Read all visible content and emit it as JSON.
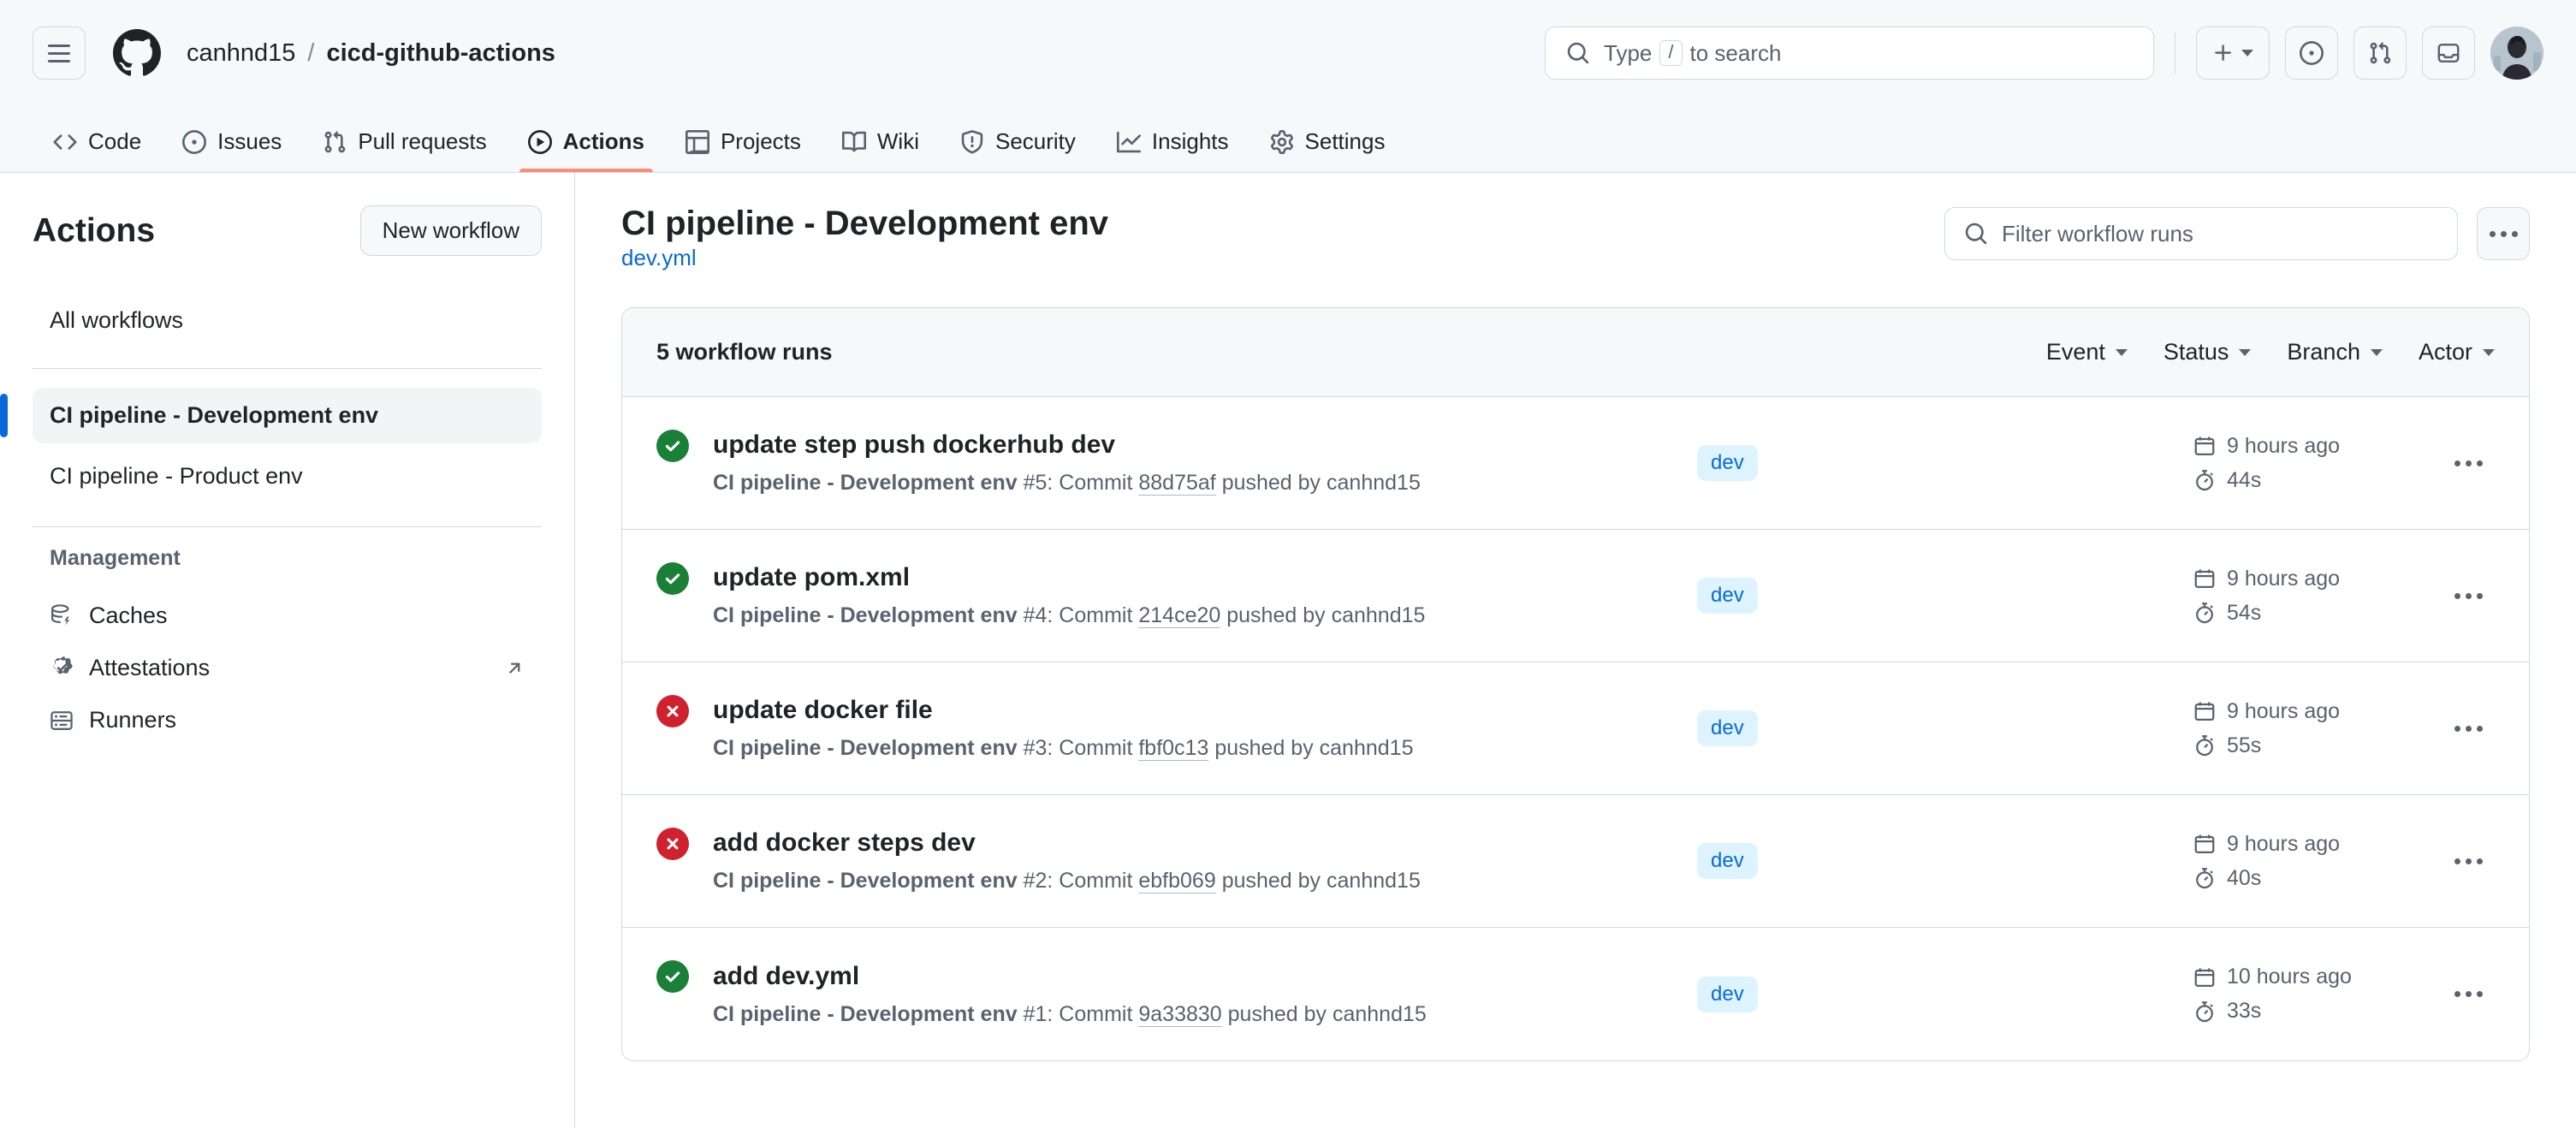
{
  "header": {
    "hamburger_label": "Open navigation menu",
    "breadcrumb": {
      "owner": "canhnd15",
      "separator": "/",
      "repo": "cicd-github-actions"
    },
    "search": {
      "placeholder_prefix": "Type",
      "placeholder_key": "/",
      "placeholder_suffix": "to search"
    },
    "icons": {
      "github_logo": "github-mark-icon",
      "search": "search-icon",
      "create_new": "plus-icon",
      "create_new_caret": "chevron-down-icon",
      "issues": "issue-opened-icon",
      "pull_requests": "git-pull-request-icon",
      "inbox": "inbox-icon",
      "avatar": "user-avatar"
    }
  },
  "repo_nav": {
    "items": [
      {
        "label": "Code",
        "icon": "code-icon",
        "active": false
      },
      {
        "label": "Issues",
        "icon": "issue-opened-icon",
        "active": false
      },
      {
        "label": "Pull requests",
        "icon": "git-pull-request-icon",
        "active": false
      },
      {
        "label": "Actions",
        "icon": "play-icon",
        "active": true
      },
      {
        "label": "Projects",
        "icon": "table-icon",
        "active": false
      },
      {
        "label": "Wiki",
        "icon": "book-icon",
        "active": false
      },
      {
        "label": "Security",
        "icon": "shield-icon",
        "active": false
      },
      {
        "label": "Insights",
        "icon": "graph-icon",
        "active": false
      },
      {
        "label": "Settings",
        "icon": "gear-icon",
        "active": false
      }
    ]
  },
  "sidebar": {
    "title": "Actions",
    "new_workflow_label": "New workflow",
    "all_workflows_label": "All workflows",
    "workflows": [
      {
        "label": "CI pipeline - Development env",
        "active": true
      },
      {
        "label": "CI pipeline - Product env",
        "active": false
      }
    ],
    "management_label": "Management",
    "management_items": [
      {
        "label": "Caches",
        "icon": "cache-icon",
        "external": false
      },
      {
        "label": "Attestations",
        "icon": "verified-check-icon",
        "external": true
      },
      {
        "label": "Runners",
        "icon": "server-icon",
        "external": false
      }
    ]
  },
  "main": {
    "title": "CI pipeline - Development env",
    "subtitle": "dev.yml",
    "filter_placeholder": "Filter workflow runs",
    "kebab_label": "More options",
    "runs_count_label": "5 workflow runs",
    "filters": [
      {
        "label": "Event"
      },
      {
        "label": "Status"
      },
      {
        "label": "Branch"
      },
      {
        "label": "Actor"
      }
    ],
    "runs": [
      {
        "status": "success",
        "status_icon": "check-circle-fill-icon",
        "title": "update step push dockerhub dev",
        "workflow_name": "CI pipeline - Development env",
        "run_number": "#5",
        "commit_word": "Commit",
        "commit_sha": "88d75af",
        "pushed_by_text": "pushed by",
        "actor": "canhnd15",
        "branch": "dev",
        "time_ago": "9 hours ago",
        "duration": "44s"
      },
      {
        "status": "success",
        "status_icon": "check-circle-fill-icon",
        "title": "update pom.xml",
        "workflow_name": "CI pipeline - Development env",
        "run_number": "#4",
        "commit_word": "Commit",
        "commit_sha": "214ce20",
        "pushed_by_text": "pushed by",
        "actor": "canhnd15",
        "branch": "dev",
        "time_ago": "9 hours ago",
        "duration": "54s"
      },
      {
        "status": "failure",
        "status_icon": "x-circle-fill-icon",
        "title": "update docker file",
        "workflow_name": "CI pipeline - Development env",
        "run_number": "#3",
        "commit_word": "Commit",
        "commit_sha": "fbf0c13",
        "pushed_by_text": "pushed by",
        "actor": "canhnd15",
        "branch": "dev",
        "time_ago": "9 hours ago",
        "duration": "55s"
      },
      {
        "status": "failure",
        "status_icon": "x-circle-fill-icon",
        "title": "add docker steps dev",
        "workflow_name": "CI pipeline - Development env",
        "run_number": "#2",
        "commit_word": "Commit",
        "commit_sha": "ebfb069",
        "pushed_by_text": "pushed by",
        "actor": "canhnd15",
        "branch": "dev",
        "time_ago": "9 hours ago",
        "duration": "40s"
      },
      {
        "status": "success",
        "status_icon": "check-circle-fill-icon",
        "title": "add dev.yml",
        "workflow_name": "CI pipeline - Development env",
        "run_number": "#1",
        "commit_word": "Commit",
        "commit_sha": "9a33830",
        "pushed_by_text": "pushed by",
        "actor": "canhnd15",
        "branch": "dev",
        "time_ago": "10 hours ago",
        "duration": "33s"
      }
    ]
  },
  "colors": {
    "accent": "#0969da",
    "success": "#1a7f37",
    "failure": "#cf222e",
    "active_tab_underline": "#fd8c73",
    "badge_bg": "#ddf4ff",
    "header_bg": "#f6f8fa",
    "border": "#d1d9e0",
    "muted_text": "#59636e"
  }
}
